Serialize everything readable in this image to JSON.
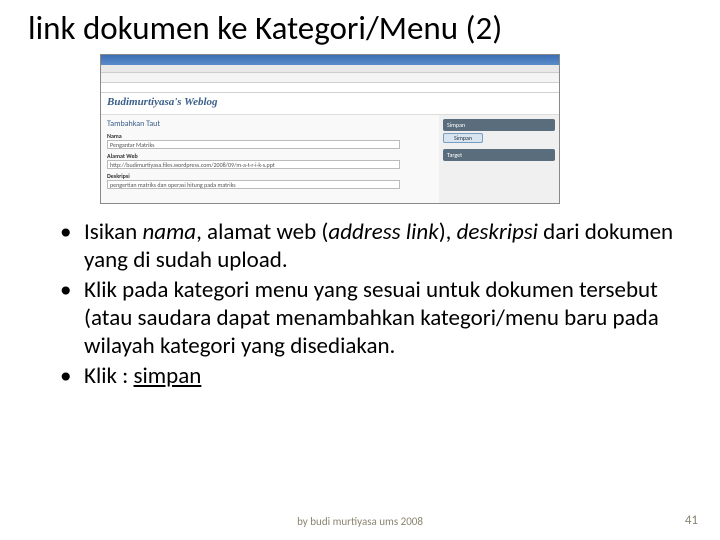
{
  "title": "link dokumen ke Kategori/Menu (2)",
  "screenshot": {
    "weblog_title": "Budimurtiyasa's Weblog",
    "tab_head": "Tambahkan Taut",
    "labels": {
      "nama": "Nama",
      "alamat": "Alamat Web",
      "deskripsi": "Deskripsi"
    },
    "values": {
      "nama": "Pengantar Matriks",
      "alamat": "http://budimurtiyasa.files.wordpress.com/2008/09/m-a-t-r-i-k-s.ppt",
      "deskripsi": "pengertian matriks dan operasi hitung pada matriks"
    },
    "sidebar": {
      "simpan": "Simpan",
      "target": "Target"
    }
  },
  "bullets": {
    "b1_pre": "Isikan ",
    "b1_i1": "nama",
    "b1_mid1": ", alamat web (",
    "b1_i2": "address link",
    "b1_mid2": "), ",
    "b1_i3": "deskripsi",
    "b1_post": " dari dokumen yang di sudah upload.",
    "b2": "Klik pada kategori menu yang sesuai  untuk dokumen tersebut (atau saudara dapat menambahkan kategori/menu baru pada wilayah kategori yang disediakan.",
    "b3_pre": "Klik : ",
    "b3_u": "simpan"
  },
  "footer": "by budi murtiyasa ums 2008",
  "page_number": "41"
}
